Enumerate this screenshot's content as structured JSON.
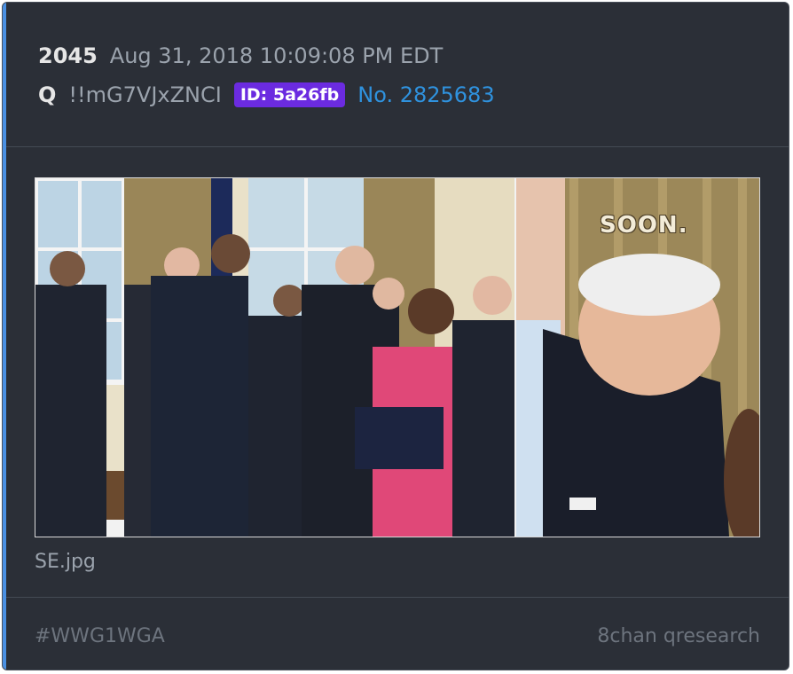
{
  "post": {
    "number": "2045",
    "datetime": "Aug 31, 2018 10:09:08 PM EDT",
    "author": "Q",
    "tripcode": "!!mG7VJxZNCI",
    "id_label": "ID: 5a26fb",
    "post_no": "No. 2825683"
  },
  "image": {
    "overlay_text": "SOON.",
    "filename": "SE.jpg"
  },
  "footer": {
    "hashtag": "#WWG1WGA",
    "source": "8chan qresearch"
  },
  "colors": {
    "card_bg": "#2b2f37",
    "accent": "#4a90e2",
    "id_badge": "#6b2be0",
    "post_link": "#2f92de"
  }
}
